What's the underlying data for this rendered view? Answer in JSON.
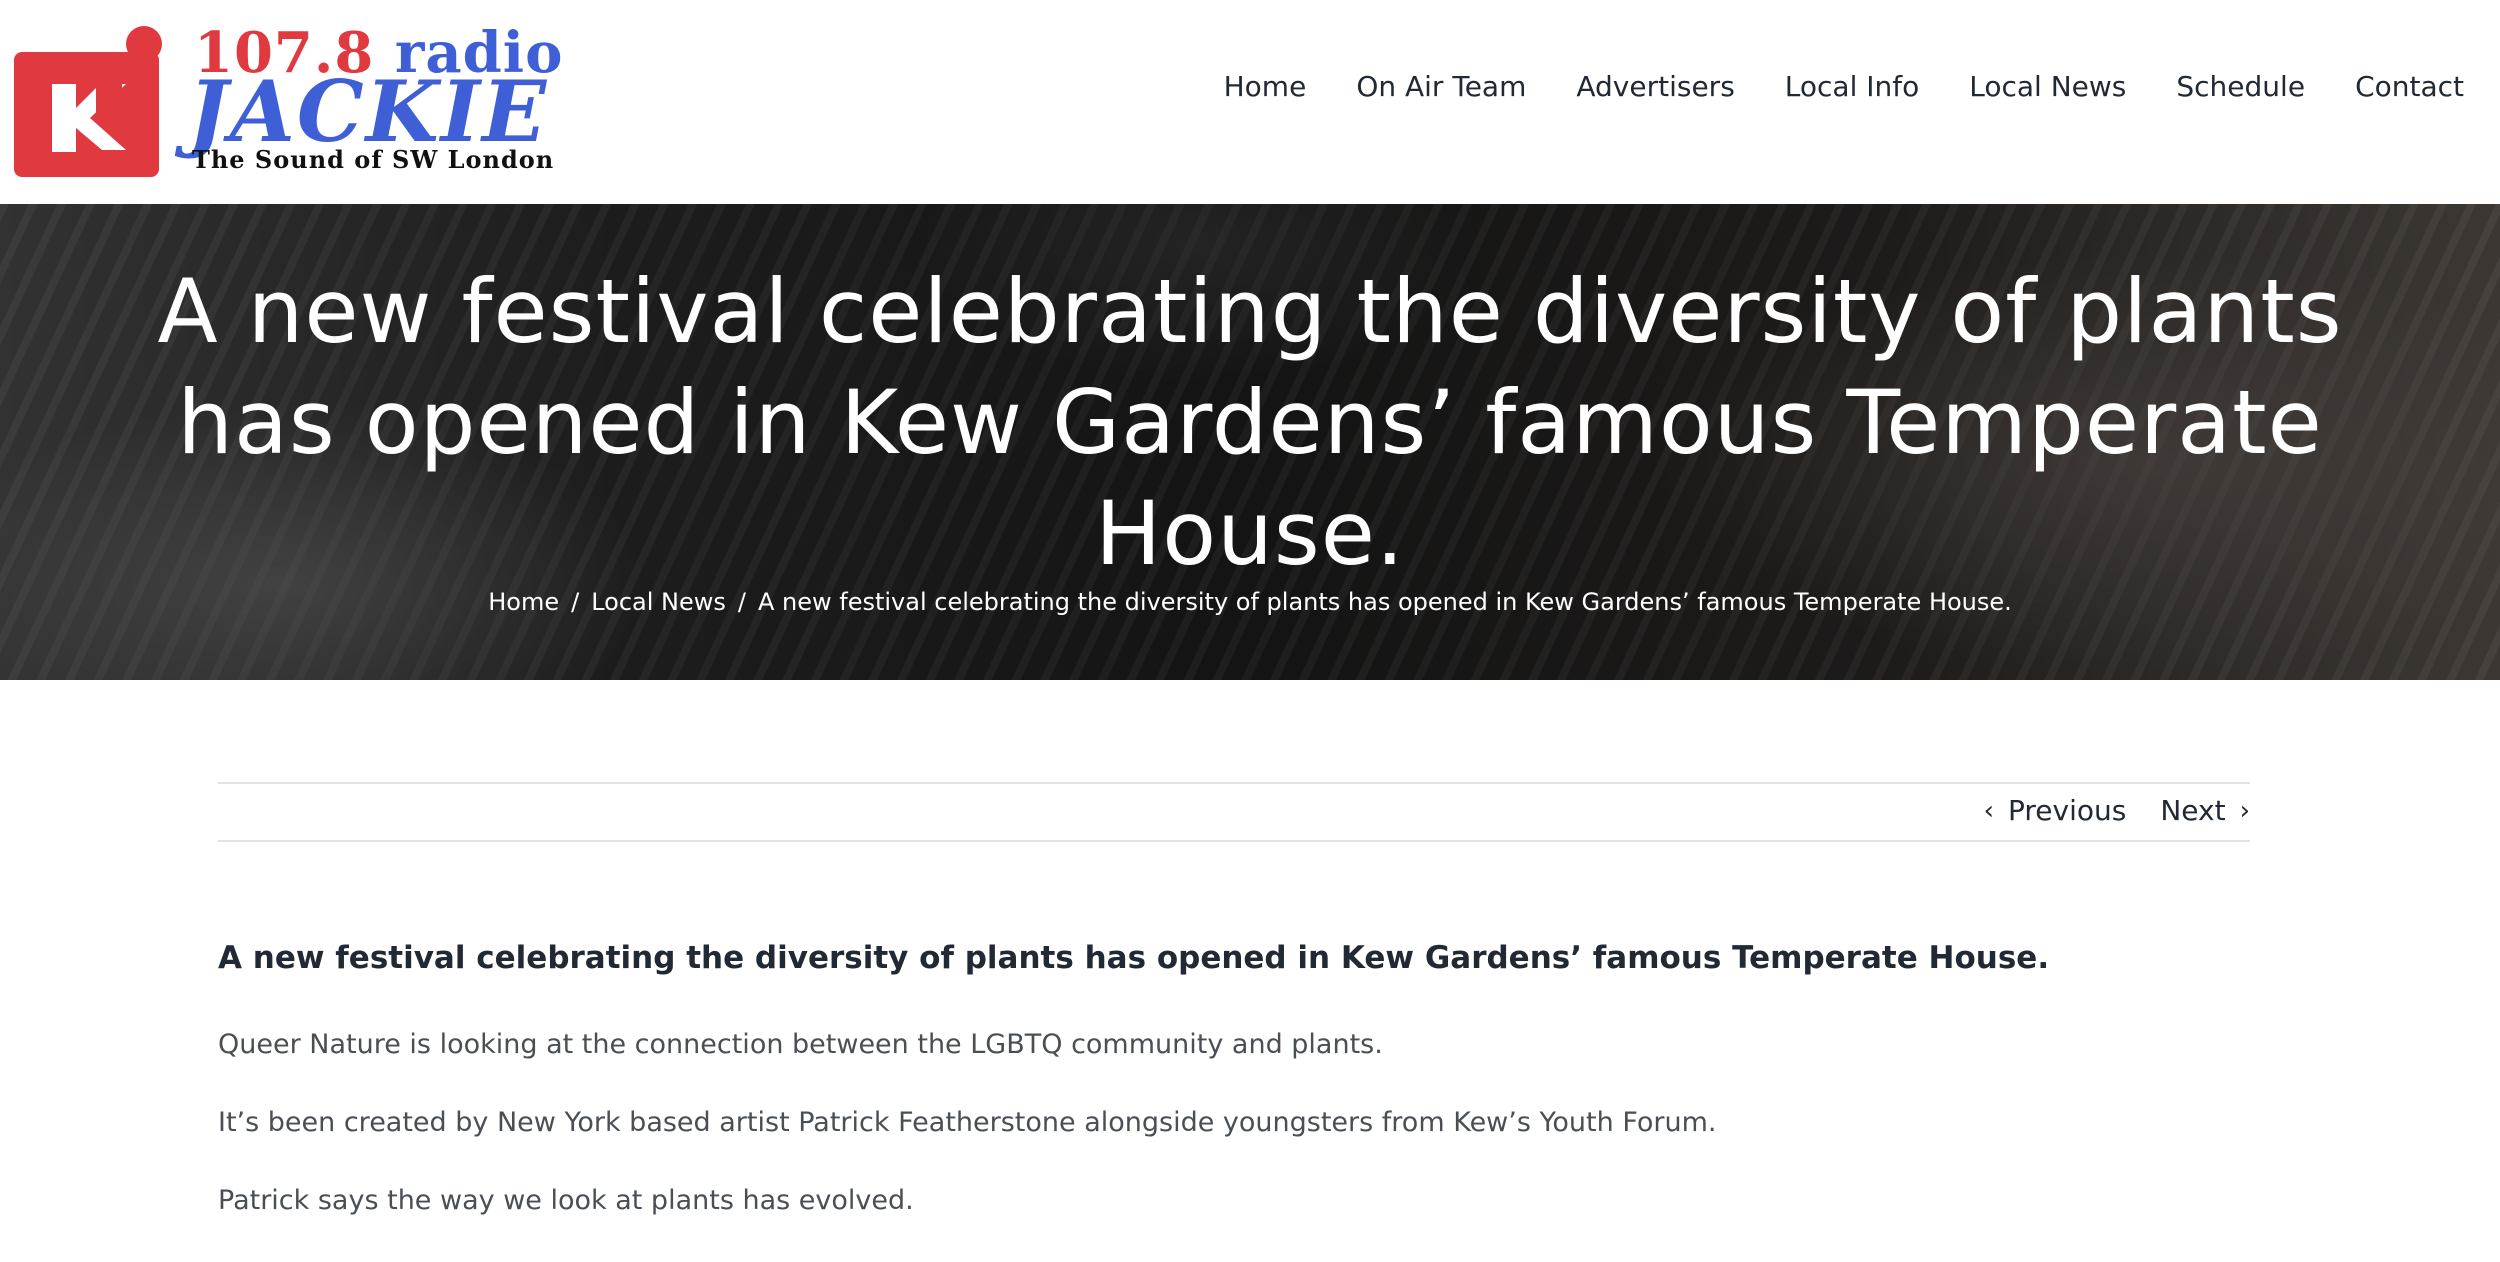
{
  "logo": {
    "frequency": "107.8",
    "top_word": "radio",
    "name": "JACKIE",
    "tagline": "The Sound of SW London",
    "colors": {
      "red": "#e0393f",
      "blue": "#3f5fd6"
    }
  },
  "nav": {
    "items": [
      {
        "label": "Home"
      },
      {
        "label": "On Air Team"
      },
      {
        "label": "Advertisers"
      },
      {
        "label": "Local Info"
      },
      {
        "label": "Local News"
      },
      {
        "label": "Schedule"
      },
      {
        "label": "Contact"
      }
    ]
  },
  "hero": {
    "title": "A new festival celebrating the diversity of plants has opened in Kew Gardens’ famous Temperate House.",
    "breadcrumb": {
      "home": "Home",
      "section": "Local News",
      "current": "A new festival celebrating the diversity of plants has opened in Kew Gardens’ famous Temperate House.",
      "separator": "/"
    }
  },
  "post_nav": {
    "previous_label": "Previous",
    "next_label": "Next",
    "previous_icon": "chevron-left-icon",
    "next_icon": "chevron-right-icon"
  },
  "article": {
    "heading": "A new festival celebrating the diversity of plants has opened in Kew Gardens’ famous Temperate House.",
    "paragraphs": [
      "Queer Nature is looking at the connection between the LGBTQ community and plants.",
      "It’s been created by New York based artist Patrick Featherstone alongside youngsters from Kew’s Youth Forum.",
      "Patrick says the way we look at plants has evolved."
    ]
  }
}
